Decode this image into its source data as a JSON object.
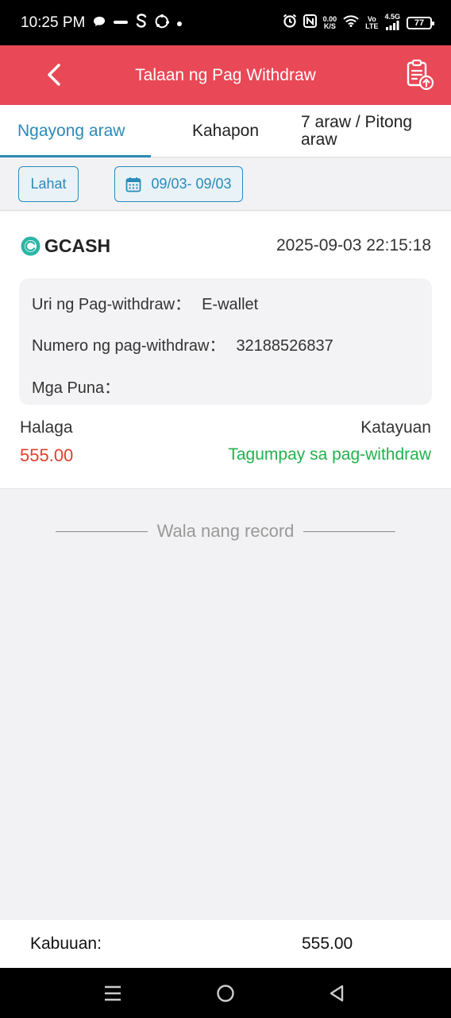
{
  "status_bar": {
    "time": "10:25 PM",
    "speed_value": "0.00",
    "speed_unit": "K/S",
    "volte_top": "Vo",
    "volte_bottom": "LTE",
    "network": "4.5G",
    "battery": "77",
    "icons": [
      "chat-bubble-icon",
      "gcash-notification-icon",
      "s-app-icon",
      "sync-icon",
      "dot-icon",
      "alarm-icon",
      "nfc-icon",
      "wifi-icon",
      "signal-icon",
      "battery-icon"
    ]
  },
  "header": {
    "title": "Talaan ng Pag Withdraw",
    "color": "#e94856"
  },
  "tabs": [
    {
      "label": "Ngayong araw",
      "active": true
    },
    {
      "label": "Kahapon",
      "active": false
    },
    {
      "label": "7 araw / Pitong araw",
      "active": false
    }
  ],
  "filters": {
    "all_label": "Lahat",
    "date_range": "09/03- 09/03"
  },
  "record": {
    "provider": "GCASH",
    "datetime": "2025-09-03 22:15:18",
    "type_label": "Uri ng Pag-withdraw：",
    "type_value": "E-wallet",
    "number_label": "Numero ng pag-withdraw：",
    "number_value": "32188526837",
    "remarks_label": "Mga Puna：",
    "remarks_value": "",
    "amount_label": "Halaga",
    "amount_value": "555.00",
    "status_label": "Katayuan",
    "status_value": "Tagumpay sa pag-withdraw"
  },
  "empty_state": {
    "text": "Wala nang record"
  },
  "footer": {
    "total_label": "Kabuuan:",
    "total_value": "555.00"
  },
  "colors": {
    "accent": "#2a8ab8",
    "amount": "#e0402f",
    "success": "#22b14c",
    "gcash": "#2ab6a6"
  }
}
